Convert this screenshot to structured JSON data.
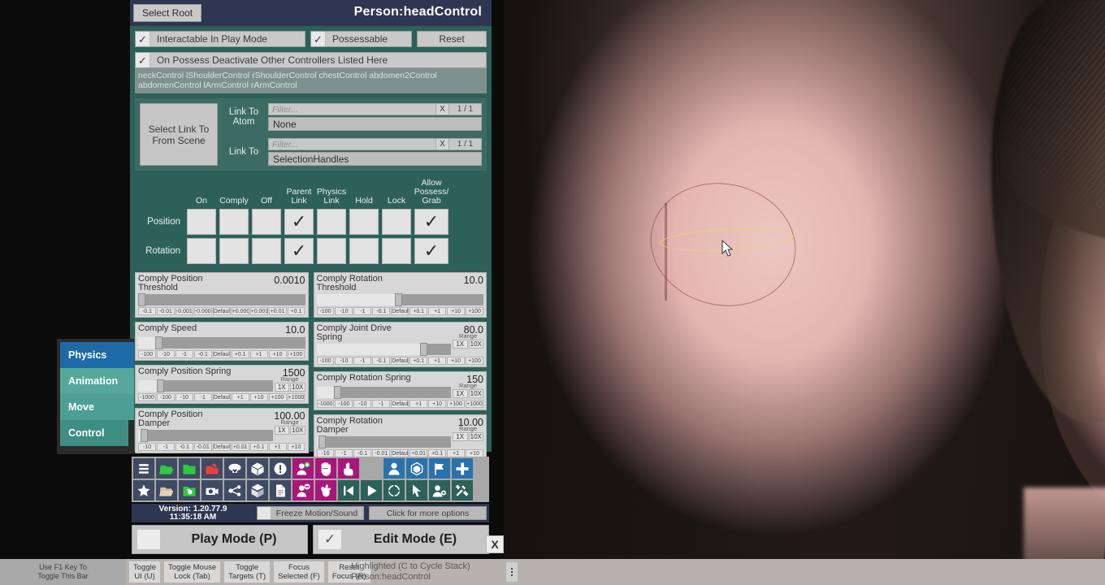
{
  "titlebar": {
    "select_root_label": "Select Root",
    "title": "Person:headControl"
  },
  "top_toggles": {
    "interactable": {
      "label": "Interactable In Play Mode",
      "checked": "✓"
    },
    "possessable": {
      "label": "Possessable",
      "checked": "✓"
    },
    "reset_label": "Reset"
  },
  "deactivate": {
    "label": "On Possess Deactivate Other Controllers Listed Here",
    "checked": "✓",
    "list_line1": "neckControl lShoulderControl rShoulderControl chestControl abdomen2Control",
    "list_line2": "abdomenControl lArmControl rArmControl"
  },
  "link": {
    "select_from_scene": "Select Link To From Scene",
    "atom_label": "Link To Atom",
    "atom_filter_placeholder": "Filter...",
    "atom_clear": "X",
    "atom_count": "1 / 1",
    "atom_value": "None",
    "target_label": "Link To",
    "target_filter_placeholder": "Filter...",
    "target_clear": "X",
    "target_count": "1 / 1",
    "target_value": "SelectionHandles"
  },
  "matrix": {
    "columns": [
      "On",
      "Comply",
      "Off",
      "Parent Link",
      "Physics Link",
      "Hold",
      "Lock",
      "Allow Possess/ Grab"
    ],
    "rows": [
      {
        "label": "Position",
        "cells": [
          "",
          "",
          "",
          "✓",
          "",
          "",
          "",
          "✓"
        ]
      },
      {
        "label": "Rotation",
        "cells": [
          "",
          "",
          "",
          "✓",
          "",
          "",
          "",
          "✓"
        ]
      }
    ]
  },
  "sliders_left": [
    {
      "name": "Comply Position Threshold",
      "value": "0.0010",
      "fill_pct": 1,
      "thumb_pct": 1,
      "has_range": false,
      "buttons": [
        "-0.1",
        "-0.01",
        "-0.001",
        "-0.0001",
        "Default",
        "+0.0001",
        "+0.001",
        "+0.01",
        "+0.1"
      ]
    },
    {
      "name": "Comply Speed",
      "value": "10.0",
      "fill_pct": 11,
      "thumb_pct": 11,
      "has_range": false,
      "buttons": [
        "-100",
        "-10",
        "-1",
        "-0.1",
        "Default",
        "+0.1",
        "+1",
        "+10",
        "+100"
      ]
    },
    {
      "name": "Comply Position Spring",
      "value": "1500",
      "fill_pct": 15,
      "thumb_pct": 15,
      "has_range": true,
      "range_label": "Range",
      "range_buttons": [
        "1X",
        "10X"
      ],
      "buttons": [
        "-1000",
        "-100",
        "-10",
        "-1",
        "Default",
        "+1",
        "+10",
        "+100",
        "+1000"
      ]
    },
    {
      "name": "Comply Position Damper",
      "value": "100.00",
      "fill_pct": 3,
      "thumb_pct": 3,
      "has_range": true,
      "range_label": "Range",
      "range_buttons": [
        "1X",
        "10X"
      ],
      "buttons": [
        "-10",
        "-1",
        "-0.1",
        "-0.01",
        "Default",
        "+0.01",
        "+0.1",
        "+1",
        "+10"
      ]
    }
  ],
  "sliders_right": [
    {
      "name": "Comply Rotation Threshold",
      "value": "10.0",
      "fill_pct": 48,
      "thumb_pct": 48,
      "has_range": false,
      "buttons": [
        "-100",
        "-10",
        "-1",
        "-0.1",
        "Default",
        "+0.1",
        "+1",
        "+10",
        "+100"
      ]
    },
    {
      "name": "Comply Joint Drive Spring",
      "value": "80.0",
      "fill_pct": 78,
      "thumb_pct": 78,
      "has_range": true,
      "range_label": "Range",
      "range_buttons": [
        "1X",
        "10X"
      ],
      "buttons": [
        "-100",
        "-10",
        "-1",
        "-0.1",
        "Default",
        "+0.1",
        "+1",
        "+10",
        "+100"
      ]
    },
    {
      "name": "Comply Rotation Spring",
      "value": "150",
      "fill_pct": 14,
      "thumb_pct": 14,
      "has_range": true,
      "range_label": "Range",
      "range_buttons": [
        "1X",
        "10X"
      ],
      "buttons": [
        "-1000",
        "-100",
        "-10",
        "-1",
        "Default",
        "+1",
        "+10",
        "+100",
        "+1000"
      ]
    },
    {
      "name": "Comply Rotation Damper",
      "value": "10.00",
      "fill_pct": 3,
      "thumb_pct": 3,
      "has_range": true,
      "range_label": "Range",
      "range_buttons": [
        "1X",
        "10X"
      ],
      "buttons": [
        "-10",
        "-1",
        "-0.1",
        "-0.01",
        "Default",
        "+0.01",
        "+0.1",
        "+1",
        "+10"
      ]
    }
  ],
  "left_tabs": [
    {
      "label": "Physics",
      "selected": true
    },
    {
      "label": "Animation",
      "selected": false
    },
    {
      "label": "Move",
      "selected": false
    },
    {
      "label": "Control",
      "selected": false
    }
  ],
  "toolbar": {
    "row1": [
      {
        "icon": "hamburger-menu-icon",
        "color": "#3f4a63",
        "glyph": "bars"
      },
      {
        "icon": "open-scene-icon",
        "color": "#3f4a63",
        "glyph": "folder-open-green"
      },
      {
        "icon": "folder-icon",
        "color": "#3f4a63",
        "glyph": "folder-green"
      },
      {
        "icon": "save-scene-icon",
        "color": "#3f4a63",
        "glyph": "folder-red"
      },
      {
        "icon": "cloud-download-icon",
        "color": "#3f4a63",
        "glyph": "cloud"
      },
      {
        "icon": "package-icon",
        "color": "#3f4a63",
        "glyph": "box"
      },
      {
        "icon": "alert-icon",
        "color": "#3f4a63",
        "glyph": "exclaim"
      },
      {
        "icon": "add-person-icon",
        "color": "#a8167a",
        "glyph": "person-plus"
      },
      {
        "icon": "open-hand-icon",
        "color": "#a8167a",
        "glyph": "hand-open"
      },
      {
        "icon": "pointing-hand-icon",
        "color": "#a8167a",
        "glyph": "hand-point"
      },
      {
        "icon": "spacer",
        "color": "#a8a8a8",
        "glyph": "none"
      },
      {
        "icon": "person-icon",
        "color": "#2a72ad",
        "glyph": "person"
      },
      {
        "icon": "unity-icon",
        "color": "#2a72ad",
        "glyph": "unity"
      },
      {
        "icon": "flag-icon",
        "color": "#2a72ad",
        "glyph": "flag"
      },
      {
        "icon": "plus-icon",
        "color": "#2a72ad",
        "glyph": "plus"
      }
    ],
    "row2": [
      {
        "icon": "favorites-star-icon",
        "color": "#3f4a63",
        "glyph": "star"
      },
      {
        "icon": "load-look-icon",
        "color": "#3f4a63",
        "glyph": "folder-open-tan"
      },
      {
        "icon": "screenshot-folder-icon",
        "color": "#3f4a63",
        "glyph": "folder-camera"
      },
      {
        "icon": "camera-icon",
        "color": "#3f4a63",
        "glyph": "camera"
      },
      {
        "icon": "node-graph-icon",
        "color": "#3f4a63",
        "glyph": "nodes"
      },
      {
        "icon": "package-manager-icon",
        "color": "#3f4a63",
        "glyph": "box-open"
      },
      {
        "icon": "log-icon",
        "color": "#3f4a63",
        "glyph": "document"
      },
      {
        "icon": "remove-person-icon",
        "color": "#a8167a",
        "glyph": "person-minus"
      },
      {
        "icon": "grab-hand-icon",
        "color": "#a8167a",
        "glyph": "hand-grab"
      },
      {
        "icon": "rewind-icon",
        "color": "#2d6058",
        "glyph": "skip-back"
      },
      {
        "icon": "play-icon",
        "color": "#2d6058",
        "glyph": "play"
      },
      {
        "icon": "target-icon",
        "color": "#2d6058",
        "glyph": "target"
      },
      {
        "icon": "select-cursor-icon",
        "color": "#2d6058",
        "glyph": "cursor"
      },
      {
        "icon": "person-settings-icon",
        "color": "#2d6058",
        "glyph": "person-gear"
      },
      {
        "icon": "tools-icon",
        "color": "#2d6058",
        "glyph": "tools"
      }
    ]
  },
  "version_bar": {
    "version": "Version: 1.20.77.9",
    "time": "11:35:18 AM",
    "freeze_label": "Freeze Motion/Sound",
    "more_options_label": "Click for more options"
  },
  "mode_bar": {
    "play_label": "Play Mode (P)",
    "play_checked": "",
    "edit_label": "Edit Mode (E)",
    "edit_checked": "✓",
    "close_label": "X"
  },
  "bottom_bar": {
    "hint_line1": "Use F1 Key To",
    "hint_line2": "Toggle This Bar",
    "buttons": [
      {
        "line1": "Toggle",
        "line2": "UI (U)"
      },
      {
        "line1": "Toggle Mouse",
        "line2": "Lock (Tab)"
      },
      {
        "line1": "Toggle",
        "line2": "Targets (T)"
      },
      {
        "line1": "Focus",
        "line2": "Selected (F)"
      },
      {
        "line1": "Reset",
        "line2": "Focus (R)"
      }
    ],
    "status_line1": "Highlighted (C to Cycle Stack)",
    "status_line2": "Person:headControl"
  },
  "colors": {
    "panel_teal": "#2d6058",
    "title_navy": "#2f3651",
    "accent_blue": "#1c6ba8",
    "magenta": "#a8167a",
    "selection_yellow": "#e8d46a"
  }
}
